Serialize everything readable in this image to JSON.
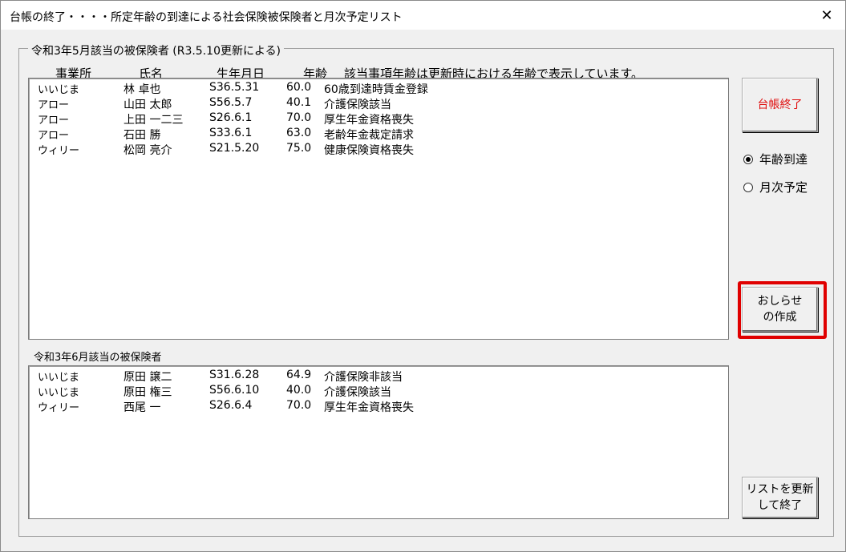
{
  "window": {
    "title": "台帳の終了・・・・所定年齢の到達による社会保険被保険者と月次予定リスト",
    "close_glyph": "✕"
  },
  "frame": {
    "legend": "令和3年5月該当の被保険者 (R3.5.10更新による)"
  },
  "headers": [
    "事業所",
    "氏名",
    "生年月日",
    "年齢",
    "該当事項年齢は更新時における年齢で表示しています。"
  ],
  "list1": [
    [
      "いいじま",
      "林 卓也",
      "S36.5.31",
      "60.0",
      "60歳到達時賃金登録"
    ],
    [
      "アロー",
      "山田 太郎",
      "S56.5.7",
      "40.1",
      "介護保険該当"
    ],
    [
      "アロー",
      "上田 一二三",
      "S26.6.1",
      "70.0",
      "厚生年金資格喪失"
    ],
    [
      "アロー",
      "石田 勝",
      "S33.6.1",
      "63.0",
      "老齢年金裁定請求"
    ],
    [
      "ウィリー",
      "松岡 亮介",
      "S21.5.20",
      "75.0",
      "健康保険資格喪失"
    ]
  ],
  "section2": {
    "label": "令和3年6月該当の被保険者"
  },
  "list2": [
    [
      "いいじま",
      "原田 譲二",
      "S31.6.28",
      "64.9",
      "介護保険非該当"
    ],
    [
      "いいじま",
      "原田 権三",
      "S56.6.10",
      "40.0",
      "介護保険該当"
    ],
    [
      "ウィリー",
      "西尾 一",
      "S26.6.4",
      "70.0",
      "厚生年金資格喪失"
    ]
  ],
  "buttons": {
    "close_ledger": "台帳終了",
    "notice_line1": "おしらせ",
    "notice_line2": "の作成",
    "update_line1": "リストを更新",
    "update_line2": "して終了"
  },
  "radios": {
    "age_reached": {
      "label": "年齢到達",
      "selected": true
    },
    "monthly": {
      "label": "月次予定",
      "selected": false
    }
  },
  "colors": {
    "close_button_text": "#e01010",
    "highlight_border": "#e00000"
  }
}
